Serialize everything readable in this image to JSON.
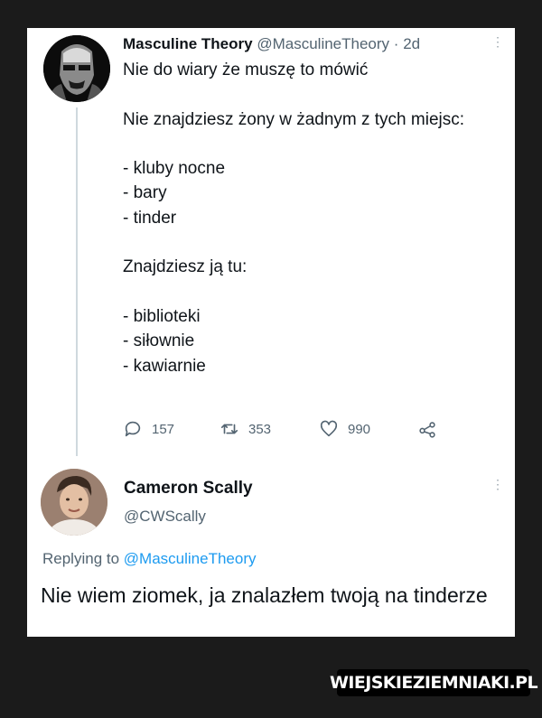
{
  "tweet": {
    "author_name": "Masculine Theory",
    "author_handle": "@MasculineTheory",
    "separator": "·",
    "time": "2d",
    "text": "Nie do wiary że muszę to mówić\n\nNie znajdziesz żony w żadnym z tych miejsc:\n\n- kluby nocne\n- bary\n- tinder\n\nZnajdziesz ją tu:\n\n- biblioteki\n- siłownie\n- kawiarnie",
    "actions": {
      "reply_icon": "comment-icon",
      "reply_count": "157",
      "retweet_icon": "retweet-icon",
      "retweet_count": "353",
      "like_icon": "heart-icon",
      "like_count": "990",
      "share_icon": "share-icon"
    }
  },
  "reply": {
    "author_name": "Cameron Scally",
    "author_handle": "@CWScally",
    "replying_prefix": "Replying to",
    "replying_to": "@MasculineTheory",
    "text": "Nie wiem ziomek, ja znalazłem twoją na tinderze"
  },
  "watermark": "WIEJSKIEZIEMNIAKI.PL",
  "colors": {
    "link": "#1d9bf0",
    "secondary_text": "#536471",
    "background": "#1b1b1b"
  }
}
